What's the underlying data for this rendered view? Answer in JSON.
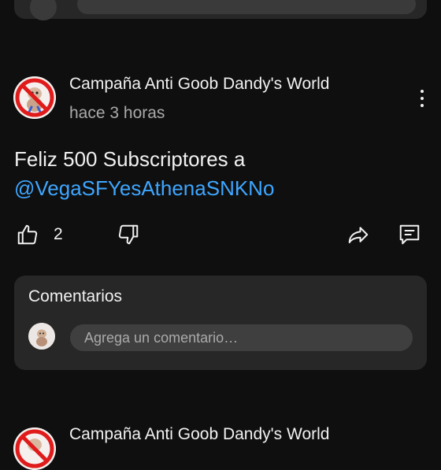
{
  "post": {
    "channel_name": "Campaña Anti Goob Dandy's World",
    "timestamp": "hace 3 horas",
    "text_line1": "Feliz 500 Subscriptores a",
    "mention": "@VegaSFYesAthenaSNKNo",
    "like_count": "2"
  },
  "comments": {
    "title": "Comentarios",
    "placeholder": "Agrega un comentario…"
  },
  "next_post": {
    "channel_name": "Campaña Anti Goob Dandy's World"
  },
  "colors": {
    "background": "#0f0f0f",
    "card": "#272727",
    "mention": "#3ea6ff",
    "secondary_text": "#aaaaaa",
    "prohibition_red": "#e01b1b"
  },
  "icons": {
    "avatar": "no-goob-sign-icon",
    "like": "thumbs-up-icon",
    "dislike": "thumbs-down-icon",
    "share": "share-icon",
    "comments": "comment-icon",
    "menu": "more-vert-icon"
  }
}
